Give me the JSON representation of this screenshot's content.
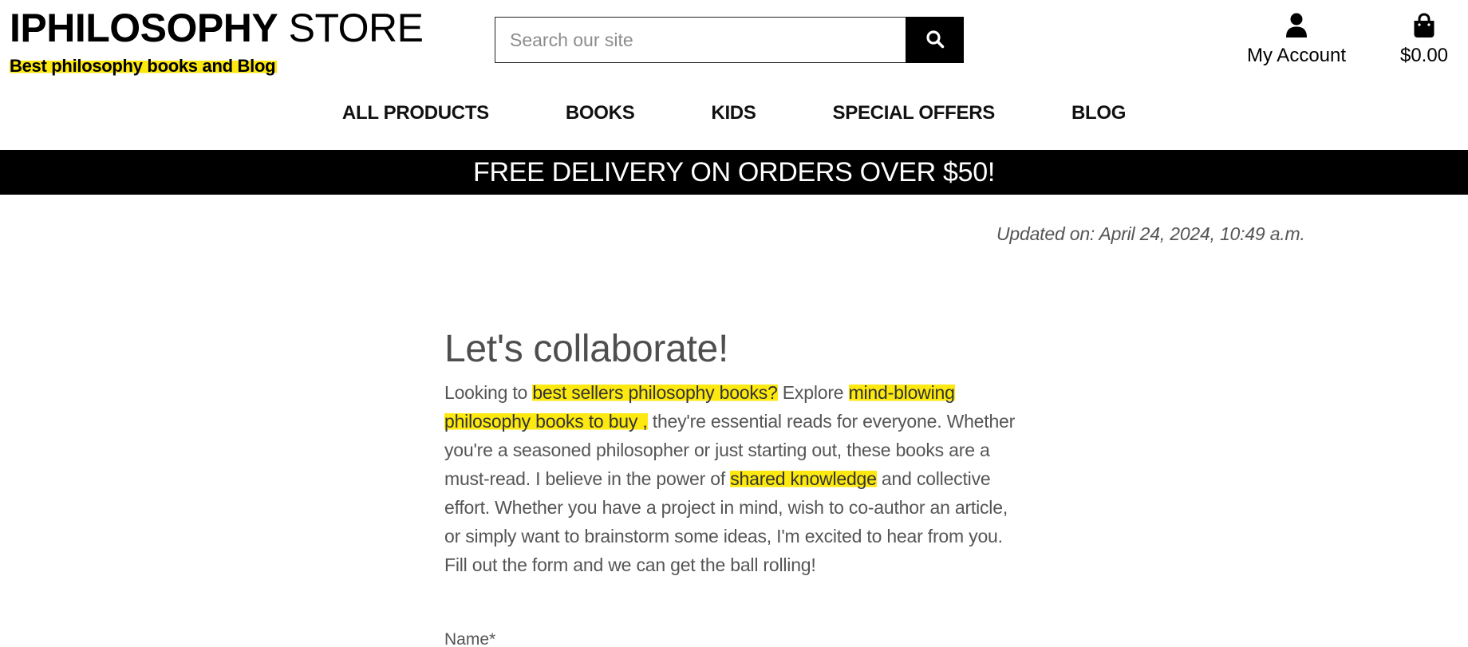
{
  "header": {
    "brand_bold": "IPHILOSOPHY",
    "brand_light": " STORE",
    "tagline": "Best philosophy books and Blog",
    "search_placeholder": "Search our site",
    "account_label": "My Account",
    "cart_total": "$0.00",
    "icons": {
      "search": "search-icon",
      "account": "user-icon",
      "cart": "shopping-bag-icon"
    }
  },
  "nav": {
    "items": [
      {
        "label": "ALL PRODUCTS"
      },
      {
        "label": "BOOKS"
      },
      {
        "label": "KIDS"
      },
      {
        "label": "SPECIAL OFFERS"
      },
      {
        "label": "BLOG"
      }
    ]
  },
  "banner": {
    "text": "FREE DELIVERY ON ORDERS OVER $50!"
  },
  "post": {
    "updated": "Updated on: April 24, 2024, 10:49 a.m.",
    "title": "Let's collaborate!",
    "body": {
      "t1": "Looking to ",
      "h1": "best sellers philosophy books?",
      "t2": " Explore ",
      "h2": "mind-blowing philosophy books to buy ,",
      "t3": " they're essential reads for everyone. Whether you're a seasoned philosopher or just starting out, these books are a must-read. I believe in the power of ",
      "h3": "shared knowledge",
      "t4": " and collective effort. Whether you have a project in mind, wish to co-author an article, or simply want to brainstorm some ideas, I'm excited to hear from you. Fill out the form and we can get the ball rolling!"
    },
    "form_name_label": "Name*"
  },
  "colors": {
    "highlight": "#fde910",
    "banner_bg": "#000000",
    "banner_text": "#ffffff",
    "body_text": "#555555"
  }
}
